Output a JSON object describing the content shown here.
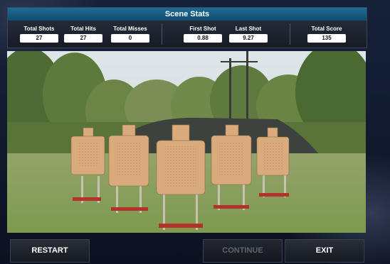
{
  "stats": {
    "title": "Scene Stats",
    "items": [
      {
        "label": "Total Shots",
        "value": "27"
      },
      {
        "label": "Total Hits",
        "value": "27"
      },
      {
        "label": "Total Misses",
        "value": "0"
      },
      {
        "label": "First Shot",
        "value": "0.88"
      },
      {
        "label": "Last Shot",
        "value": "9.27"
      },
      {
        "label": "Total Score",
        "value": "135"
      }
    ]
  },
  "buttons": {
    "restart": "RESTART",
    "continue": "CONTINUE",
    "exit": "EXIT"
  },
  "colors": {
    "header": "#1e6c97",
    "target": "#d9ab7c",
    "stand": "#b3322c"
  }
}
